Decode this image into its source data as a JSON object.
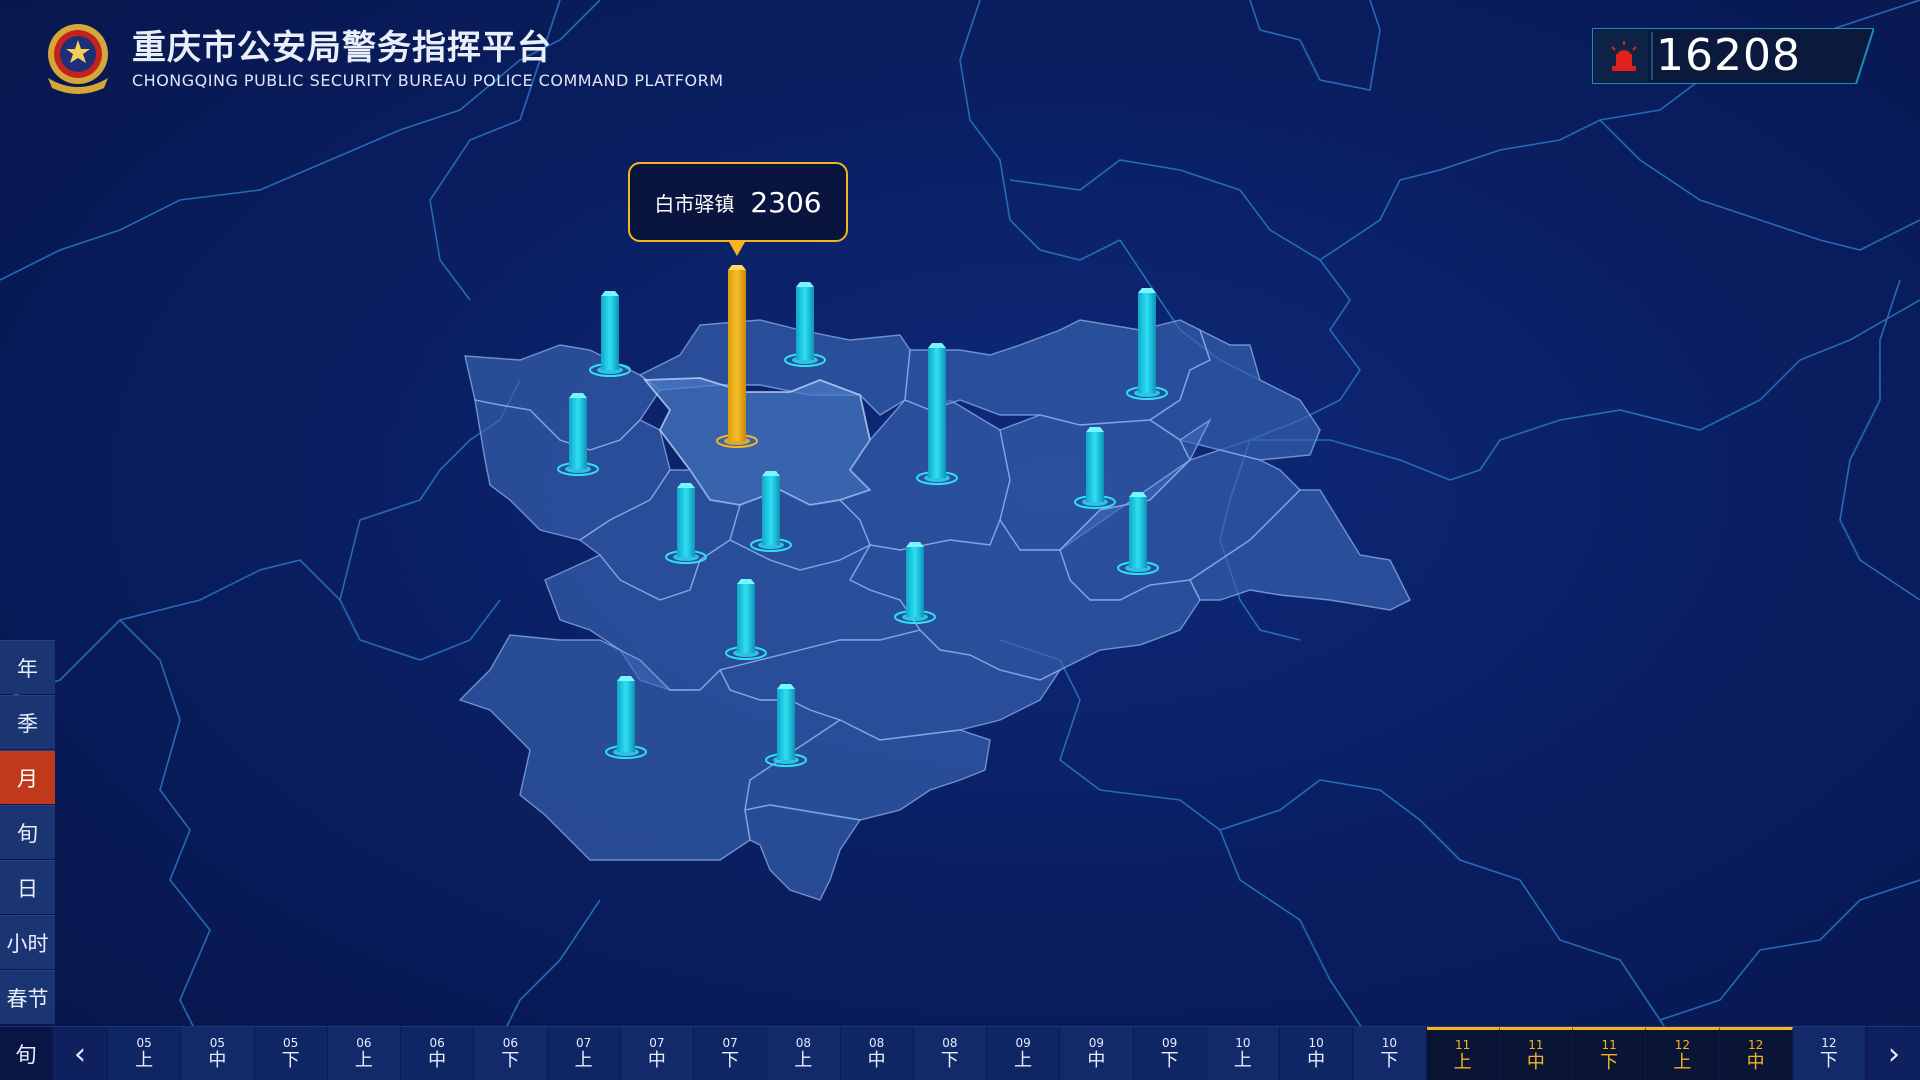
{
  "header": {
    "title_cn": "重庆市公安局警务指挥平台",
    "title_en": "CHONGQING PUBLIC SECURITY BUREAU POLICE COMMAND PLATFORM",
    "emblem_icon": "police-emblem-icon"
  },
  "counter": {
    "value": "16208",
    "icon": "alarm-siren-icon",
    "accent_color": "#e0211b"
  },
  "tooltip": {
    "name": "白市驿镇",
    "value": "2306",
    "border_color": "#f5b520"
  },
  "map": {
    "bar_color": "#19c9e6",
    "highlight_bar_color": "#f5b520",
    "region_fill": "#3b68b4",
    "highlighted_region": "白市驿镇"
  },
  "period_menu": {
    "items": [
      "年",
      "季",
      "月",
      "旬",
      "日",
      "小时",
      "春节"
    ],
    "active": "月"
  },
  "timeline": {
    "mode_label": "旬",
    "prev_icon": "chevron-left-icon",
    "next_icon": "chevron-right-icon",
    "cells": [
      {
        "month": "05",
        "part": "上",
        "selected": false
      },
      {
        "month": "05",
        "part": "中",
        "selected": false
      },
      {
        "month": "05",
        "part": "下",
        "selected": false
      },
      {
        "month": "06",
        "part": "上",
        "selected": false
      },
      {
        "month": "06",
        "part": "中",
        "selected": false
      },
      {
        "month": "06",
        "part": "下",
        "selected": false
      },
      {
        "month": "07",
        "part": "上",
        "selected": false
      },
      {
        "month": "07",
        "part": "中",
        "selected": false
      },
      {
        "month": "07",
        "part": "下",
        "selected": false
      },
      {
        "month": "08",
        "part": "上",
        "selected": false
      },
      {
        "month": "08",
        "part": "中",
        "selected": false
      },
      {
        "month": "08",
        "part": "下",
        "selected": false
      },
      {
        "month": "09",
        "part": "上",
        "selected": false
      },
      {
        "month": "09",
        "part": "中",
        "selected": false
      },
      {
        "month": "09",
        "part": "下",
        "selected": false
      },
      {
        "month": "10",
        "part": "上",
        "selected": false
      },
      {
        "month": "10",
        "part": "中",
        "selected": false
      },
      {
        "month": "10",
        "part": "下",
        "selected": false
      },
      {
        "month": "11",
        "part": "上",
        "selected": true
      },
      {
        "month": "11",
        "part": "中",
        "selected": true
      },
      {
        "month": "11",
        "part": "下",
        "selected": true
      },
      {
        "month": "12",
        "part": "上",
        "selected": true
      },
      {
        "month": "12",
        "part": "中",
        "selected": true
      },
      {
        "month": "12",
        "part": "下",
        "selected": false
      }
    ]
  }
}
